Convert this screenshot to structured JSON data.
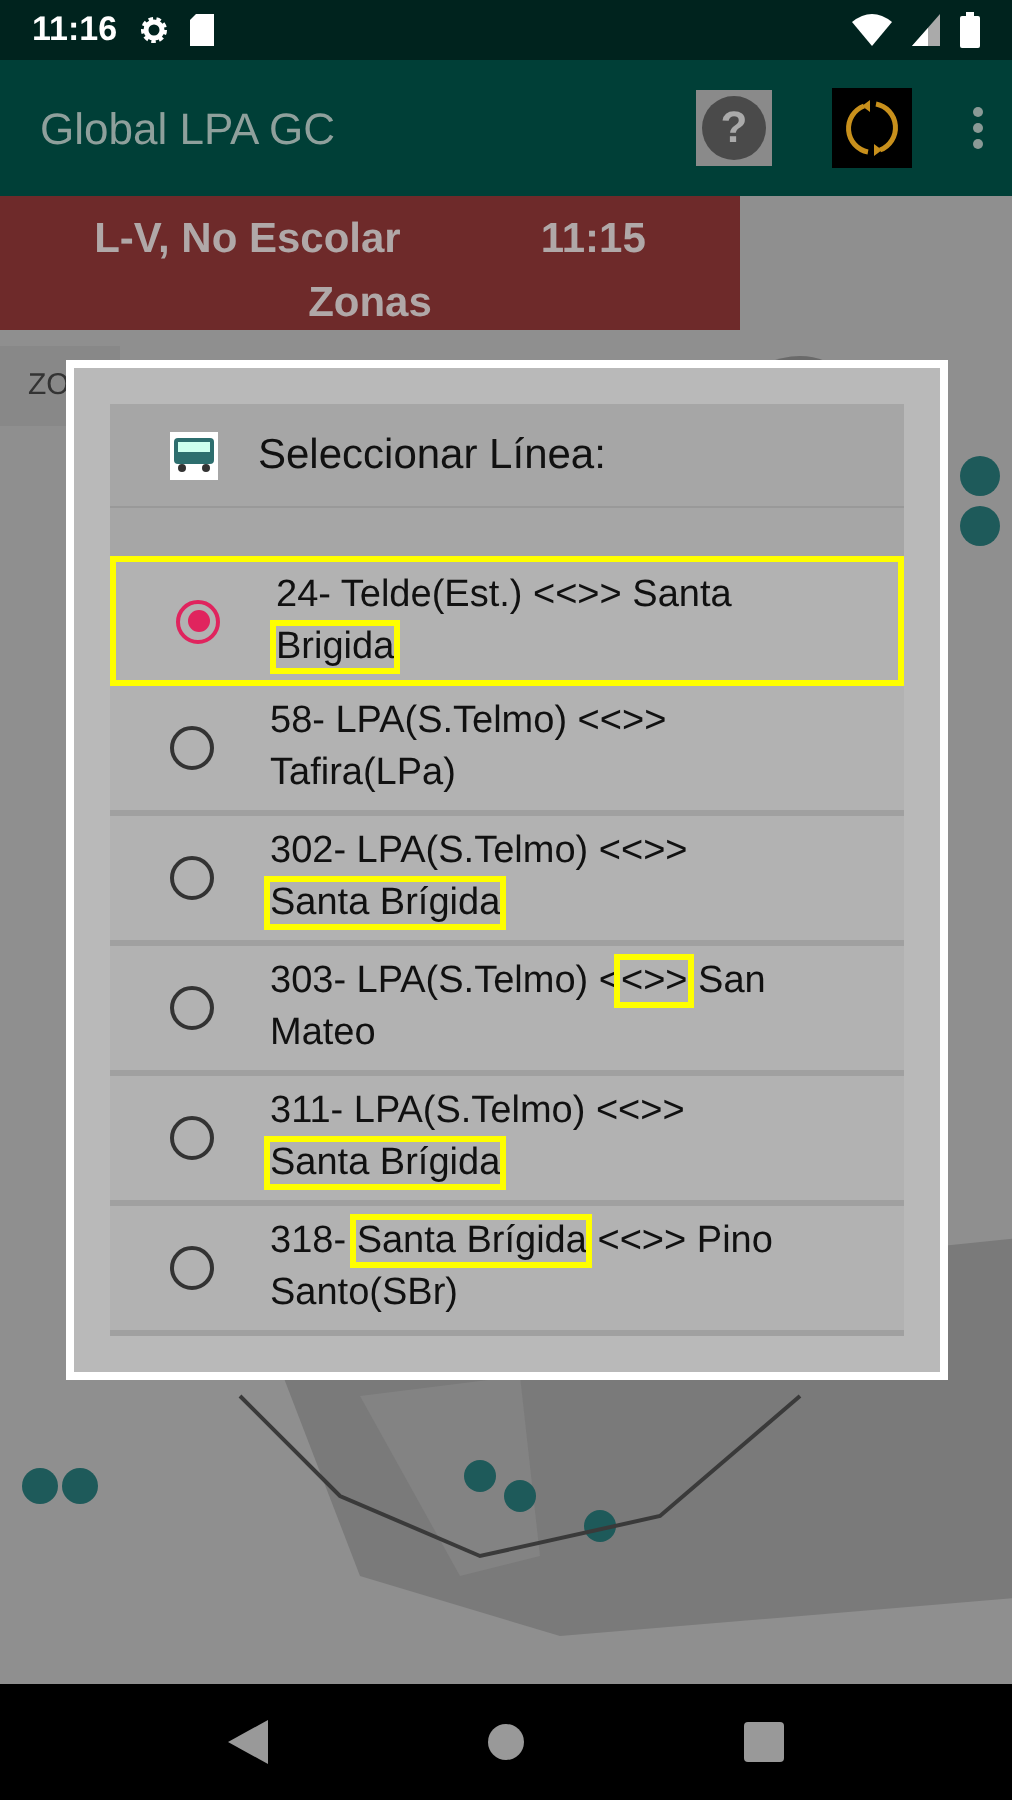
{
  "status_bar": {
    "time": "11:16"
  },
  "app_bar": {
    "title": "Global LPA GC",
    "help": "?"
  },
  "schedule_band": {
    "day_type": "L-V, No Escolar",
    "time": "11:15",
    "section": "Zonas"
  },
  "background_panel": {
    "label": "ZO"
  },
  "dialog": {
    "title": "Seleccionar Línea:",
    "options": [
      {
        "selected": true,
        "highlighted": true,
        "segments": [
          {
            "text": "24- Telde(Est.) <<>> Santa ",
            "highlighted": false
          },
          {
            "text": "Brigida",
            "highlighted": true
          }
        ]
      },
      {
        "selected": false,
        "highlighted": false,
        "segments": [
          {
            "text": "58- LPA(S.Telmo) <<>> Tafira(LPa)",
            "highlighted": false
          }
        ]
      },
      {
        "selected": false,
        "highlighted": false,
        "segments": [
          {
            "text": "302- LPA(S.Telmo) <<>> ",
            "highlighted": false
          },
          {
            "text": "Santa Brígida",
            "highlighted": true
          }
        ]
      },
      {
        "selected": false,
        "highlighted": false,
        "segments": [
          {
            "text": "303- LPA(S.Telmo) <",
            "highlighted": false
          },
          {
            "text": "<>>",
            "highlighted": true
          },
          {
            "text": " San Mateo",
            "highlighted": false
          }
        ]
      },
      {
        "selected": false,
        "highlighted": false,
        "segments": [
          {
            "text": "311- LPA(S.Telmo) <<>> ",
            "highlighted": false
          },
          {
            "text": "Santa Brígida",
            "highlighted": true
          }
        ]
      },
      {
        "selected": false,
        "highlighted": false,
        "segments": [
          {
            "text": "318- ",
            "highlighted": false
          },
          {
            "text": "Santa Brígida",
            "highlighted": true
          },
          {
            "text": " <<>> Pino Santo(SBr)",
            "highlighted": false
          }
        ]
      }
    ]
  }
}
